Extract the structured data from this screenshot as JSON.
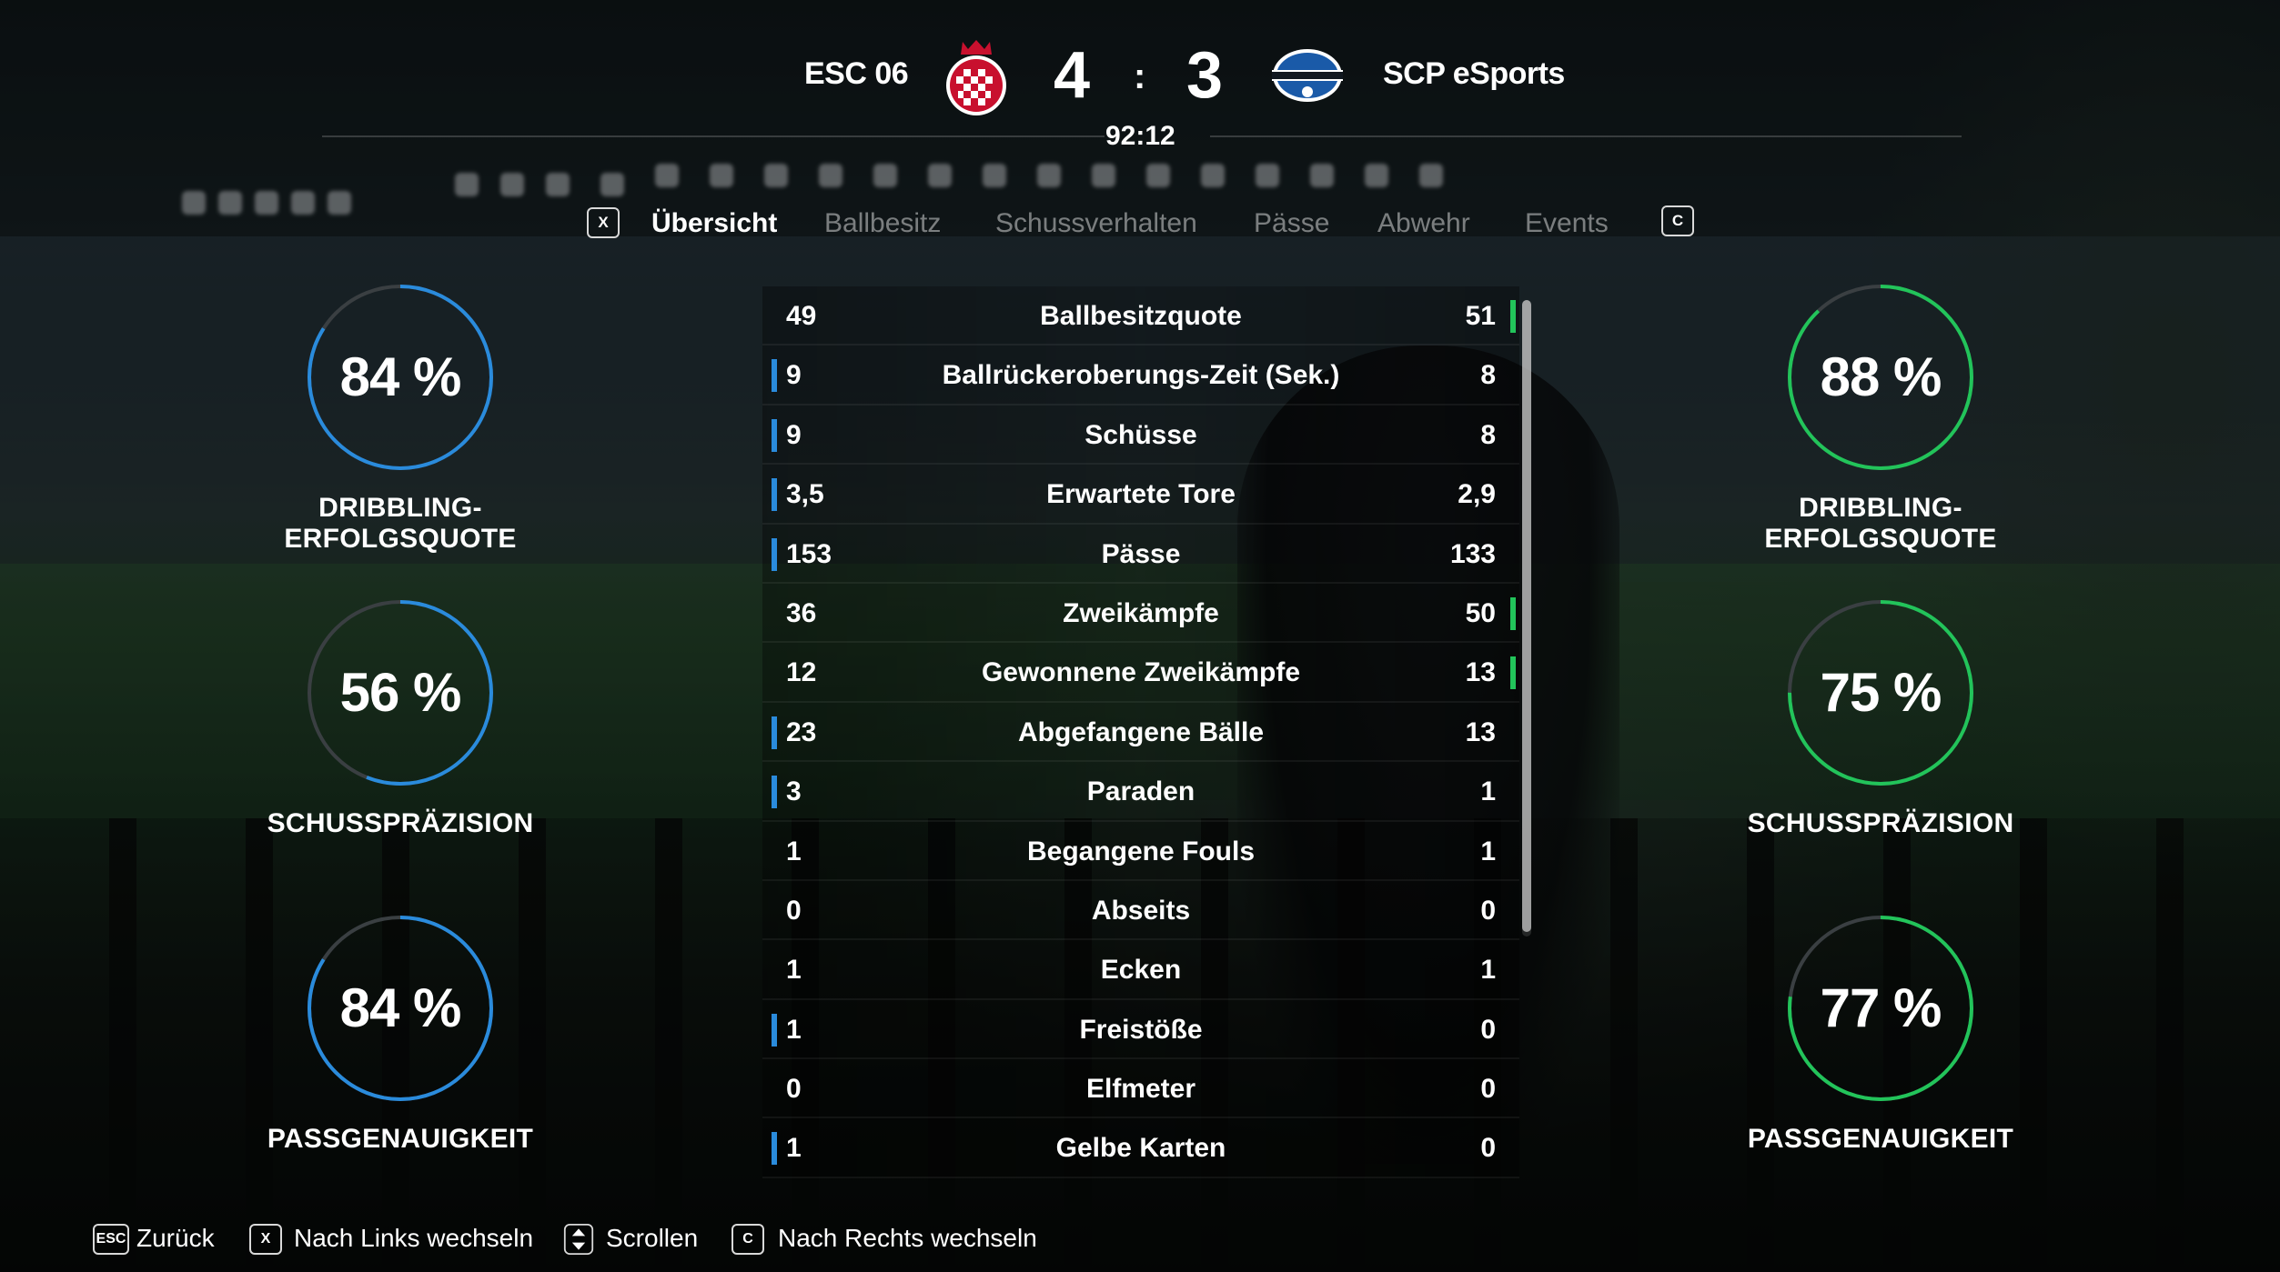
{
  "match": {
    "home_team": "ESC 06",
    "away_team": "SCP eSports",
    "home_score": "4",
    "away_score": "3",
    "separator": ":",
    "clock": "92:12",
    "away_crest_text": "SC PADERBORN 07"
  },
  "tabs": {
    "left_key": "X",
    "right_key": "C",
    "items": [
      "Übersicht",
      "Ballbesitz",
      "Schussverhalten",
      "Pässe",
      "Abwehr",
      "Events"
    ],
    "active": "Übersicht"
  },
  "home_rings": [
    {
      "value": "84 %",
      "fraction": 0.84,
      "label": "DRIBBLING-ERFOLGSQUOTE"
    },
    {
      "value": "56 %",
      "fraction": 0.56,
      "label": "SCHUSSPRÄZISION"
    },
    {
      "value": "84 %",
      "fraction": 0.84,
      "label": "PASSGENAUIGKEIT"
    }
  ],
  "away_rings": [
    {
      "value": "88 %",
      "fraction": 0.88,
      "label": "DRIBBLING-ERFOLGSQUOTE"
    },
    {
      "value": "75 %",
      "fraction": 0.75,
      "label": "SCHUSSPRÄZISION"
    },
    {
      "value": "77 %",
      "fraction": 0.77,
      "label": "PASSGENAUIGKEIT"
    }
  ],
  "stats": [
    {
      "name": "Ballbesitzquote",
      "home": "49",
      "away": "51",
      "leader": "away"
    },
    {
      "name": "Ballrückeroberungs-Zeit (Sek.)",
      "home": "9",
      "away": "8",
      "leader": "home"
    },
    {
      "name": "Schüsse",
      "home": "9",
      "away": "8",
      "leader": "home"
    },
    {
      "name": "Erwartete Tore",
      "home": "3,5",
      "away": "2,9",
      "leader": "home"
    },
    {
      "name": "Pässe",
      "home": "153",
      "away": "133",
      "leader": "home"
    },
    {
      "name": "Zweikämpfe",
      "home": "36",
      "away": "50",
      "leader": "away"
    },
    {
      "name": "Gewonnene Zweikämpfe",
      "home": "12",
      "away": "13",
      "leader": "away"
    },
    {
      "name": "Abgefangene Bälle",
      "home": "23",
      "away": "13",
      "leader": "home"
    },
    {
      "name": "Paraden",
      "home": "3",
      "away": "1",
      "leader": "home"
    },
    {
      "name": "Begangene Fouls",
      "home": "1",
      "away": "1",
      "leader": "none"
    },
    {
      "name": "Abseits",
      "home": "0",
      "away": "0",
      "leader": "none"
    },
    {
      "name": "Ecken",
      "home": "1",
      "away": "1",
      "leader": "none"
    },
    {
      "name": "Freistöße",
      "home": "1",
      "away": "0",
      "leader": "home"
    },
    {
      "name": "Elfmeter",
      "home": "0",
      "away": "0",
      "leader": "none"
    },
    {
      "name": "Gelbe Karten",
      "home": "1",
      "away": "0",
      "leader": "home"
    }
  ],
  "footer": {
    "back_key": "ESC",
    "back_label": "Zurück",
    "left_key": "X",
    "left_label": "Nach Links wechseln",
    "scroll_label": "Scrollen",
    "right_key": "C",
    "right_label": "Nach Rechts wechseln"
  },
  "colors": {
    "home_accent": "#2a8bdc",
    "away_accent": "#22c45a",
    "ring_track": "#3a3f42",
    "home_crest_red": "#c8102e",
    "away_crest_blue": "#1a5aa8"
  }
}
